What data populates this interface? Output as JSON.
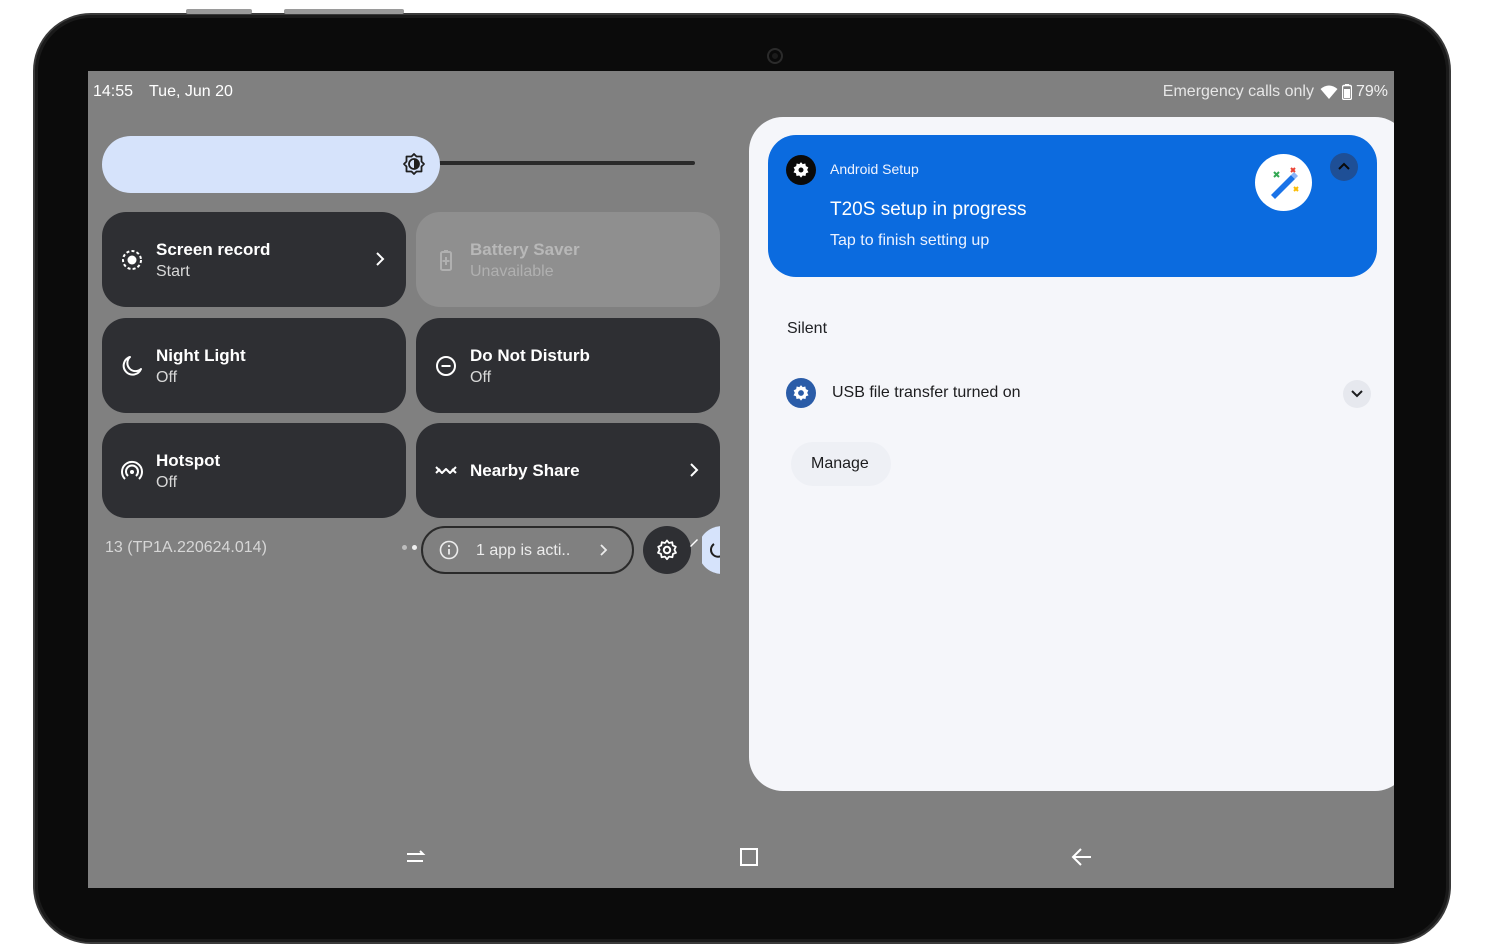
{
  "status_bar": {
    "time": "14:55",
    "date": "Tue, Jun 20",
    "carrier": "Emergency calls only",
    "battery": "79%"
  },
  "quick_settings": {
    "tiles": [
      {
        "name": "screen-record",
        "title": "Screen record",
        "subtitle": "Start",
        "has_chevron": true,
        "state": "off"
      },
      {
        "name": "battery-saver",
        "title": "Battery Saver",
        "subtitle": "Unavailable",
        "has_chevron": false,
        "state": "unavailable"
      },
      {
        "name": "night-light",
        "title": "Night Light",
        "subtitle": "Off",
        "has_chevron": false,
        "state": "off"
      },
      {
        "name": "do-not-disturb",
        "title": "Do Not Disturb",
        "subtitle": "Off",
        "has_chevron": false,
        "state": "off"
      },
      {
        "name": "hotspot",
        "title": "Hotspot",
        "subtitle": "Off",
        "has_chevron": false,
        "state": "off"
      },
      {
        "name": "nearby-share",
        "title": "Nearby Share",
        "subtitle": "",
        "has_chevron": true,
        "state": "off"
      }
    ],
    "build_number": "13 (TP1A.220624.014)",
    "active_apps_label": "1 app is acti..",
    "brightness_icon": "brightness-icon"
  },
  "notifications": {
    "setup_card": {
      "app_name": "Android Setup",
      "title": "T20S setup in progress",
      "body": "Tap to finish setting up",
      "color": "#0b6bdf"
    },
    "section_label": "Silent",
    "usb": {
      "text": "USB file transfer turned on"
    },
    "manage_label": "Manage"
  },
  "nav_bar": {
    "icons": [
      "recents-icon",
      "home-icon",
      "back-icon"
    ]
  },
  "colors": {
    "scrim": "#808080",
    "tile": "#2e2f33",
    "accent_light": "#d6e3fb",
    "shade": "#f5f6fa"
  }
}
